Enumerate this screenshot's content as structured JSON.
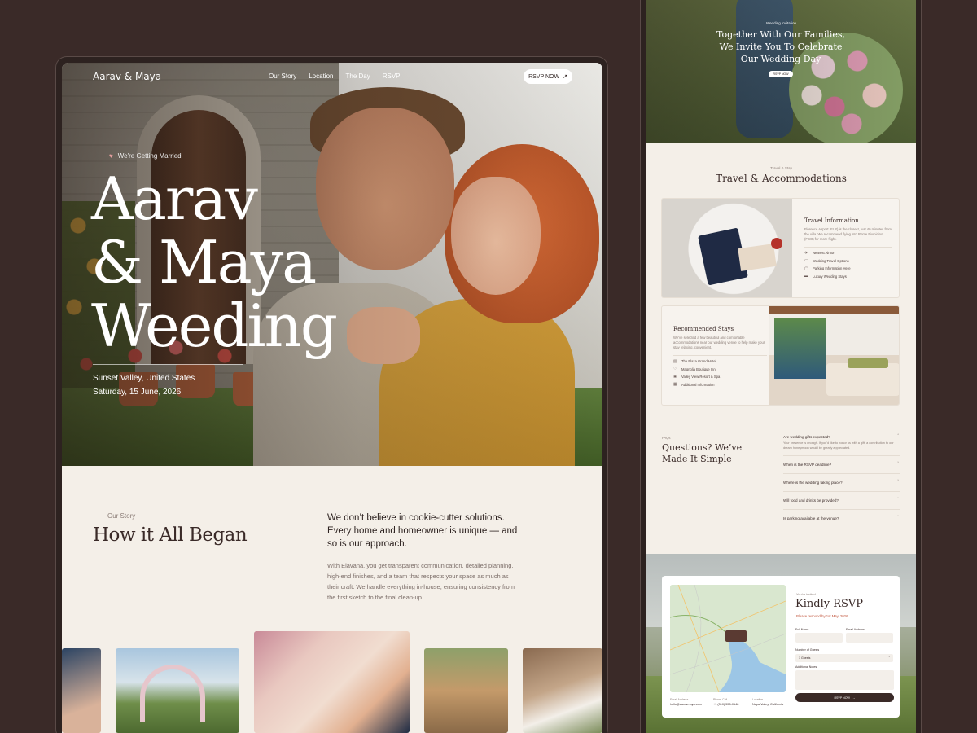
{
  "left": {
    "nav": {
      "brand": "Aarav & Maya",
      "links": [
        "Our Story",
        "Location",
        "The Day",
        "RSVP"
      ],
      "cta": "RSVP NOW",
      "cta_icon": "arrow-up-right-icon"
    },
    "hero": {
      "eyebrow": "We're Getting Married",
      "eyebrow_icon": "heart-icon",
      "title_lines": [
        "Aarav",
        "& Maya",
        "Weeding"
      ],
      "location": "Sunset Valley, United States",
      "date": "Saturday, 15 June, 2026"
    },
    "story": {
      "eyebrow": "Our Story",
      "title": "How it All Began",
      "lead": "We don’t believe in cookie-cutter solutions. Every home and homeowner is unique — and so is our approach.",
      "body": "With Elavana, you get transparent communication, detailed planning, high-end finishes, and a team that respects your space as much as their craft. We handle everything in-house, ensuring consistency from the first sketch to the final clean-up."
    }
  },
  "right": {
    "hero": {
      "eyebrow": "Wedding Invitation",
      "title": "Together With Our Families, We Invite You To Celebrate Our Wedding Day",
      "cta": "RSVP NOW"
    },
    "travel": {
      "eyebrow": "Travel & Stay",
      "title": "Travel & Accommodations",
      "info_title": "Travel Information",
      "info_text": "Florence Airport (FLR) is the closest, just 40 minutes from the villa. We recommend flying into Rome Fiumicino (FCO) for more flight.",
      "info_items": [
        "Nearest Airport",
        "Wedding Travel Options",
        "Parking Information Here",
        "Luxury Wedding Stays"
      ],
      "stays_title": "Recommended Stays",
      "stays_text": "We've selected a few beautiful and comfortable accommodations near our wedding venue to help make your stay relaxing, convenient.",
      "stays_items": [
        "The Plaza Grand Hotel",
        "Magnolia Boutique Inn",
        "Valley View Resort & Spa",
        "Additional Information"
      ]
    },
    "faq": {
      "eyebrow": "FAQs",
      "title": "Questions? We’ve Made It Simple",
      "items": [
        {
          "q": "Are wedding gifts expected?",
          "a": "Your presence is enough. If you'd like to honor us with a gift, a contribution to our dream honeymoon would be greatly appreciated."
        },
        {
          "q": "When is the RSVP deadline?",
          "a": ""
        },
        {
          "q": "Where is the wedding taking place?",
          "a": ""
        },
        {
          "q": "Will food and drinks be provided?",
          "a": ""
        },
        {
          "q": "Is parking available at the venue?",
          "a": ""
        }
      ]
    },
    "rsvp": {
      "eyebrow": "You're invited",
      "title": "Kindly RSVP",
      "deadline": "Please respond by 1st May, 2026",
      "full_name_label": "Full Name",
      "email_label": "Email Address",
      "guests_label": "Number of Guests",
      "guests_value": "1 Guests",
      "notes_label": "Additional Notes",
      "submit": "RSVP NOW",
      "contacts": [
        {
          "label": "Email Address",
          "value": "hello@aaravmaya.com"
        },
        {
          "label": "Phone Call",
          "value": "+1 (310) 555-0148"
        },
        {
          "label": "Location",
          "value": "Napa Valley, California"
        }
      ]
    }
  },
  "colors": {
    "background": "#3a2a28",
    "page": "#f4efe8",
    "accent": "#c0533a",
    "ink": "#3a2a28"
  }
}
